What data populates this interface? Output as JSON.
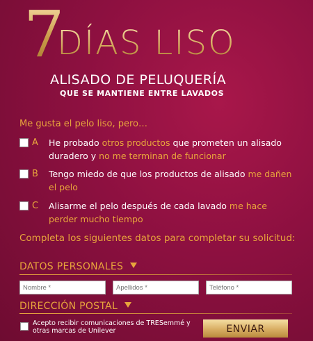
{
  "hero": {
    "seven": "7",
    "dias": "DÍAS LISO",
    "subtitle": "ALISADO DE PELUQUERÍA",
    "tagline": "QUE SE MANTIENE ENTRE LAVADOS"
  },
  "intro": "Me gusta el pelo liso, pero…",
  "options": [
    {
      "letter": "A",
      "parts": [
        {
          "t": "He probado ",
          "g": false
        },
        {
          "t": "otros productos",
          "g": true
        },
        {
          "t": " que prometen un alisado duradero y ",
          "g": false
        },
        {
          "t": "no me terminan de funcionar",
          "g": true
        }
      ]
    },
    {
      "letter": "B",
      "parts": [
        {
          "t": "Tengo miedo de que los productos de alisado ",
          "g": false
        },
        {
          "t": "me dañen el pelo",
          "g": true
        }
      ]
    },
    {
      "letter": "C",
      "parts": [
        {
          "t": "Alisarme el pelo después de cada lavado ",
          "g": false
        },
        {
          "t": "me hace perder mucho tiempo",
          "g": true
        }
      ]
    }
  ],
  "complete_text": "Completa los siguientes datos para completar su solicitud:",
  "sections": {
    "personal": "DATOS PERSONALES",
    "postal": "DIRECCIÓN POSTAL"
  },
  "fields": {
    "nombre": "Nombre *",
    "apellidos": "Apellidos *",
    "telefono": "Teléfono *"
  },
  "consent": "Acepto recibir comunicaciones de TRESemmé y otras marcas de Unilever",
  "send_label": "ENVIAR",
  "colors": {
    "accent": "#e8a53c",
    "background": "#8d1040"
  }
}
